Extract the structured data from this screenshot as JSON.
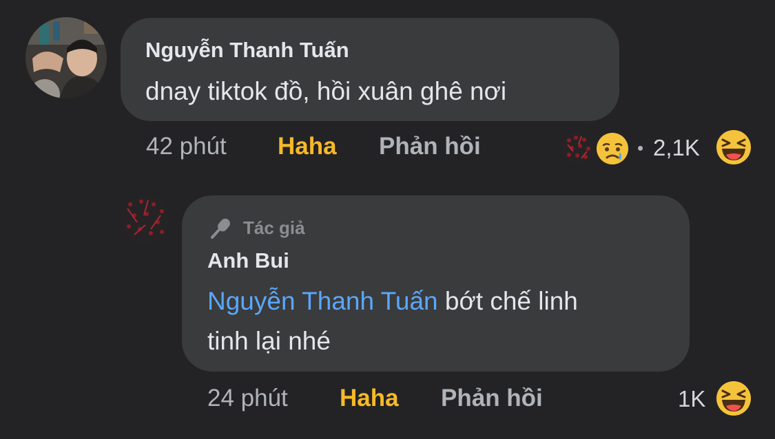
{
  "comment": {
    "author": "Nguyễn Thanh Tuấn",
    "text": "dnay tiktok đồ, hồi xuân ghê nơi",
    "time": "42 phút",
    "reaction_label": "Haha",
    "reply_label": "Phản hồi",
    "reaction_count": "2,1K",
    "separator": "•",
    "reaction_icons": [
      "heart-cluster-reaction-icon",
      "sad-reaction-icon",
      "haha-reaction-icon"
    ]
  },
  "reply": {
    "badge_label": "Tác giả",
    "badge_icon": "microphone-icon",
    "author": "Anh Bui",
    "mention": "Nguyễn Thanh Tuấn",
    "text_line1": " bớt chế linh",
    "text_line2": "tinh lại nhé",
    "time": "24 phút",
    "reaction_label": "Haha",
    "reply_label": "Phản hồi",
    "reaction_count": "1K",
    "reaction_icons": [
      "haha-reaction-icon"
    ]
  },
  "colors": {
    "background": "#232325",
    "bubble": "#3a3b3c",
    "mention": "#5aa7ff",
    "haha": "#f7b928",
    "muted": "#b0b3b8"
  }
}
